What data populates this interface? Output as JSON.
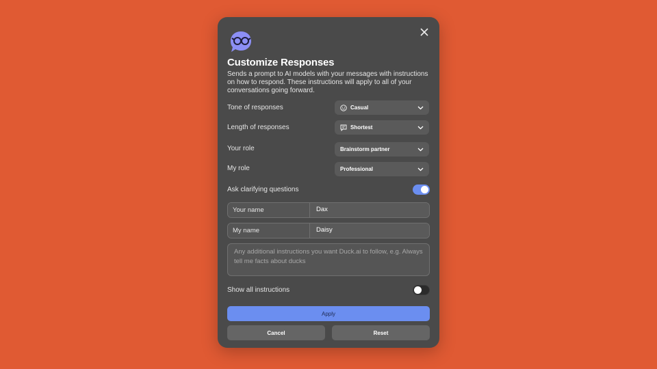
{
  "dialog": {
    "title": "Customize Responses",
    "description": "Sends a prompt to AI models with your messages with instructions on how to respond. These instructions will apply to all of your conversations going forward.",
    "close_icon": "close-icon",
    "logo_icon": "duck-with-glasses-icon"
  },
  "settings": {
    "tone": {
      "label": "Tone of responses",
      "value": "Casual",
      "icon": "smiley-icon"
    },
    "length": {
      "label": "Length of responses",
      "value": "Shortest",
      "icon": "message-lines-icon"
    },
    "your_role": {
      "label": "Your role",
      "value": "Brainstorm partner"
    },
    "my_role": {
      "label": "My role",
      "value": "Professional"
    },
    "clarifying": {
      "label": "Ask clarifying questions",
      "enabled": true
    }
  },
  "names": {
    "your_name": {
      "label": "Your name",
      "value": "Dax"
    },
    "my_name": {
      "label": "My name",
      "value": "Daisy"
    }
  },
  "instructions": {
    "placeholder": "Any additional instructions you want Duck.ai to follow, e.g. Always tell me facts about ducks"
  },
  "show_all": {
    "label": "Show all instructions",
    "enabled": false
  },
  "buttons": {
    "apply": "Apply",
    "cancel": "Cancel",
    "reset": "Reset"
  },
  "colors": {
    "background": "#E05A33",
    "modal": "#4A4A4A",
    "accent": "#6B8EF0",
    "toggle_off": "#2B2B2B"
  }
}
